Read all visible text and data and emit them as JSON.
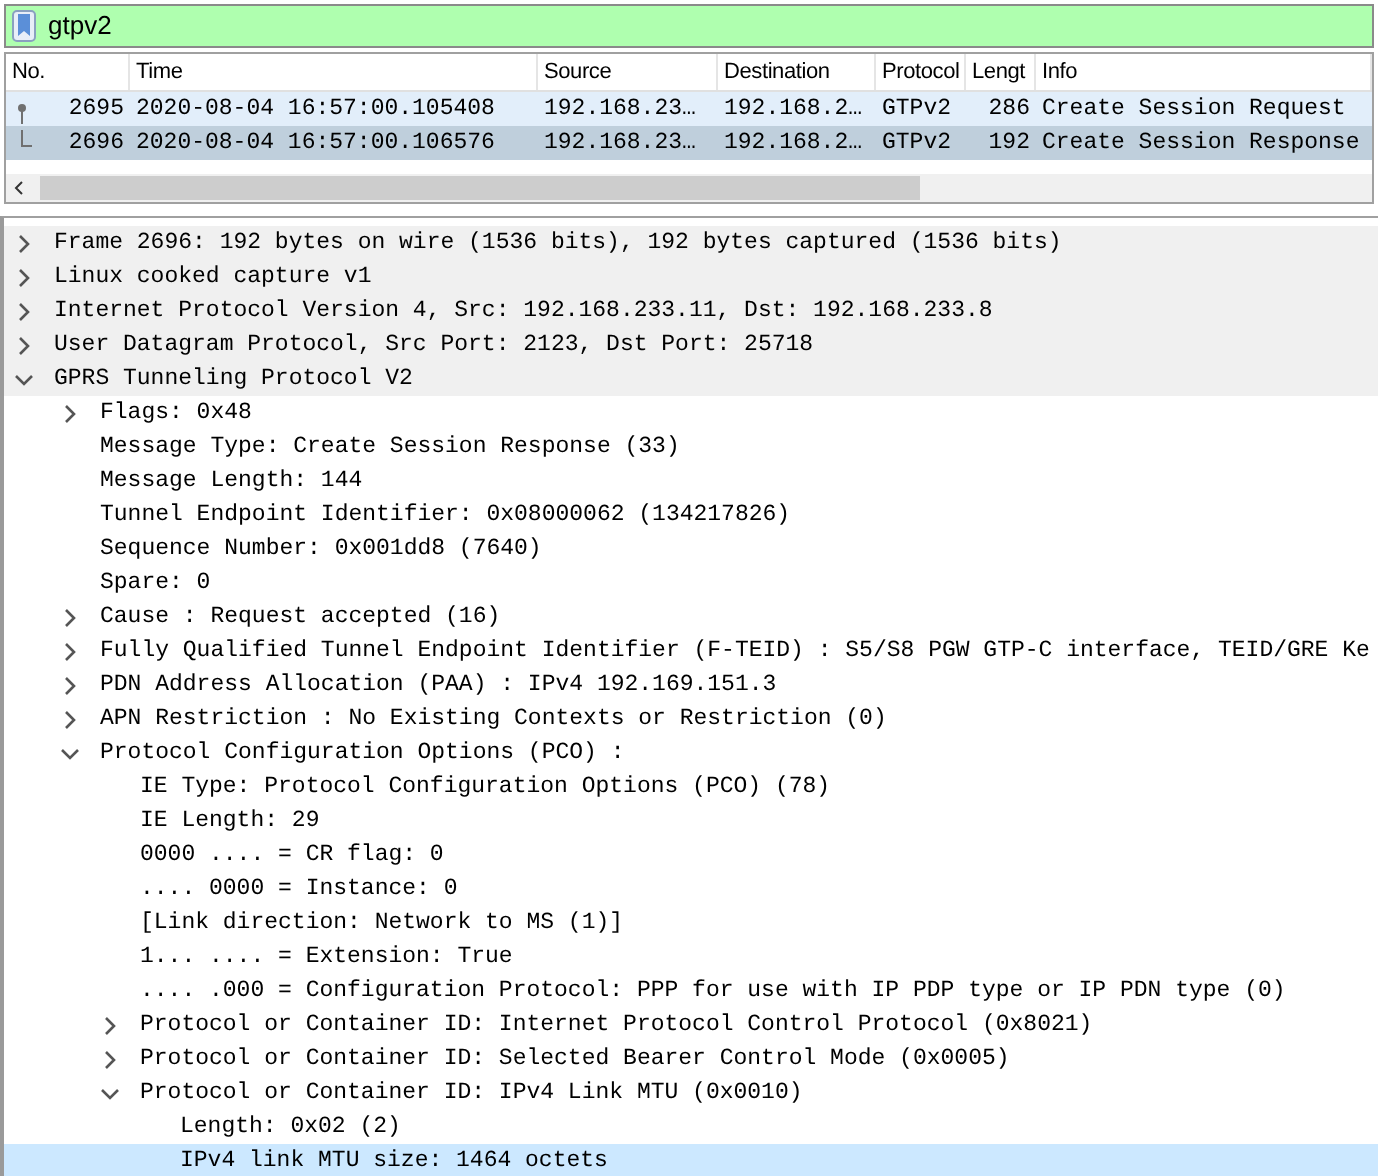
{
  "filter": {
    "value": "gtpv2"
  },
  "packet_list": {
    "columns": [
      "No.",
      "Time",
      "Source",
      "Destination",
      "Protocol",
      "Lengt",
      "Info"
    ],
    "rows": [
      {
        "cells": [
          "2695",
          "2020-08-04 16:57:00.105408",
          "192.168.23…",
          "192.168.2…",
          "GTPv2",
          "286",
          "Create Session Request"
        ],
        "selected": false,
        "kind": "request"
      },
      {
        "cells": [
          "2696",
          "2020-08-04 16:57:00.106576",
          "192.168.23…",
          "192.168.2…",
          "GTPv2",
          "192",
          "Create Session Response"
        ],
        "selected": true,
        "kind": "response"
      }
    ]
  },
  "details": [
    {
      "label": "Frame 2696: 192 bytes on wire (1536 bits), 192 bytes captured (1536 bits)",
      "expanded": false,
      "selected": false
    },
    {
      "label": "Linux cooked capture v1",
      "expanded": false,
      "selected": false
    },
    {
      "label": "Internet Protocol Version 4, Src: 192.168.233.11, Dst: 192.168.233.8",
      "expanded": false,
      "selected": false
    },
    {
      "label": "User Datagram Protocol, Src Port: 2123, Dst Port: 25718",
      "expanded": false,
      "selected": false
    },
    {
      "label": "GPRS Tunneling Protocol V2",
      "expanded": true,
      "selected": false,
      "children": [
        {
          "label": "Flags: 0x48",
          "expanded": false,
          "selected": false
        },
        {
          "label": "Message Type: Create Session Response (33)",
          "selected": false
        },
        {
          "label": "Message Length: 144",
          "selected": false
        },
        {
          "label": "Tunnel Endpoint Identifier: 0x08000062 (134217826)",
          "selected": false
        },
        {
          "label": "Sequence Number: 0x001dd8 (7640)",
          "selected": false
        },
        {
          "label": "Spare: 0",
          "selected": false
        },
        {
          "label": "Cause : Request accepted (16)",
          "expanded": false,
          "selected": false
        },
        {
          "label": "Fully Qualified Tunnel Endpoint Identifier (F-TEID) : S5/S8 PGW GTP-C interface, TEID/GRE Ke",
          "expanded": false,
          "selected": false
        },
        {
          "label": "PDN Address Allocation (PAA) : IPv4 192.169.151.3",
          "expanded": false,
          "selected": false
        },
        {
          "label": "APN Restriction : No Existing Contexts or Restriction (0)",
          "expanded": false,
          "selected": false
        },
        {
          "label": "Protocol Configuration Options (PCO) :",
          "expanded": true,
          "selected": false,
          "children": [
            {
              "label": "IE Type: Protocol Configuration Options (PCO) (78)",
              "selected": false
            },
            {
              "label": "IE Length: 29",
              "selected": false
            },
            {
              "label": "0000 .... = CR flag: 0",
              "selected": false
            },
            {
              "label": ".... 0000 = Instance: 0",
              "selected": false
            },
            {
              "label": "[Link direction: Network to MS (1)]",
              "selected": false
            },
            {
              "label": "1... .... = Extension: True",
              "selected": false
            },
            {
              "label": ".... .000 = Configuration Protocol: PPP for use with IP PDP type or IP PDN type (0)",
              "selected": false
            },
            {
              "label": "Protocol or Container ID: Internet Protocol Control Protocol (0x8021)",
              "expanded": false,
              "selected": false
            },
            {
              "label": "Protocol or Container ID: Selected Bearer Control Mode (0x0005)",
              "expanded": false,
              "selected": false
            },
            {
              "label": "Protocol or Container ID: IPv4 Link MTU (0x0010)",
              "expanded": true,
              "selected": false,
              "children": [
                {
                  "label": "Length: 0x02 (2)",
                  "selected": false
                },
                {
                  "label": "IPv4 link MTU size: 1464 octets",
                  "selected": true
                }
              ]
            }
          ]
        }
      ]
    }
  ]
}
